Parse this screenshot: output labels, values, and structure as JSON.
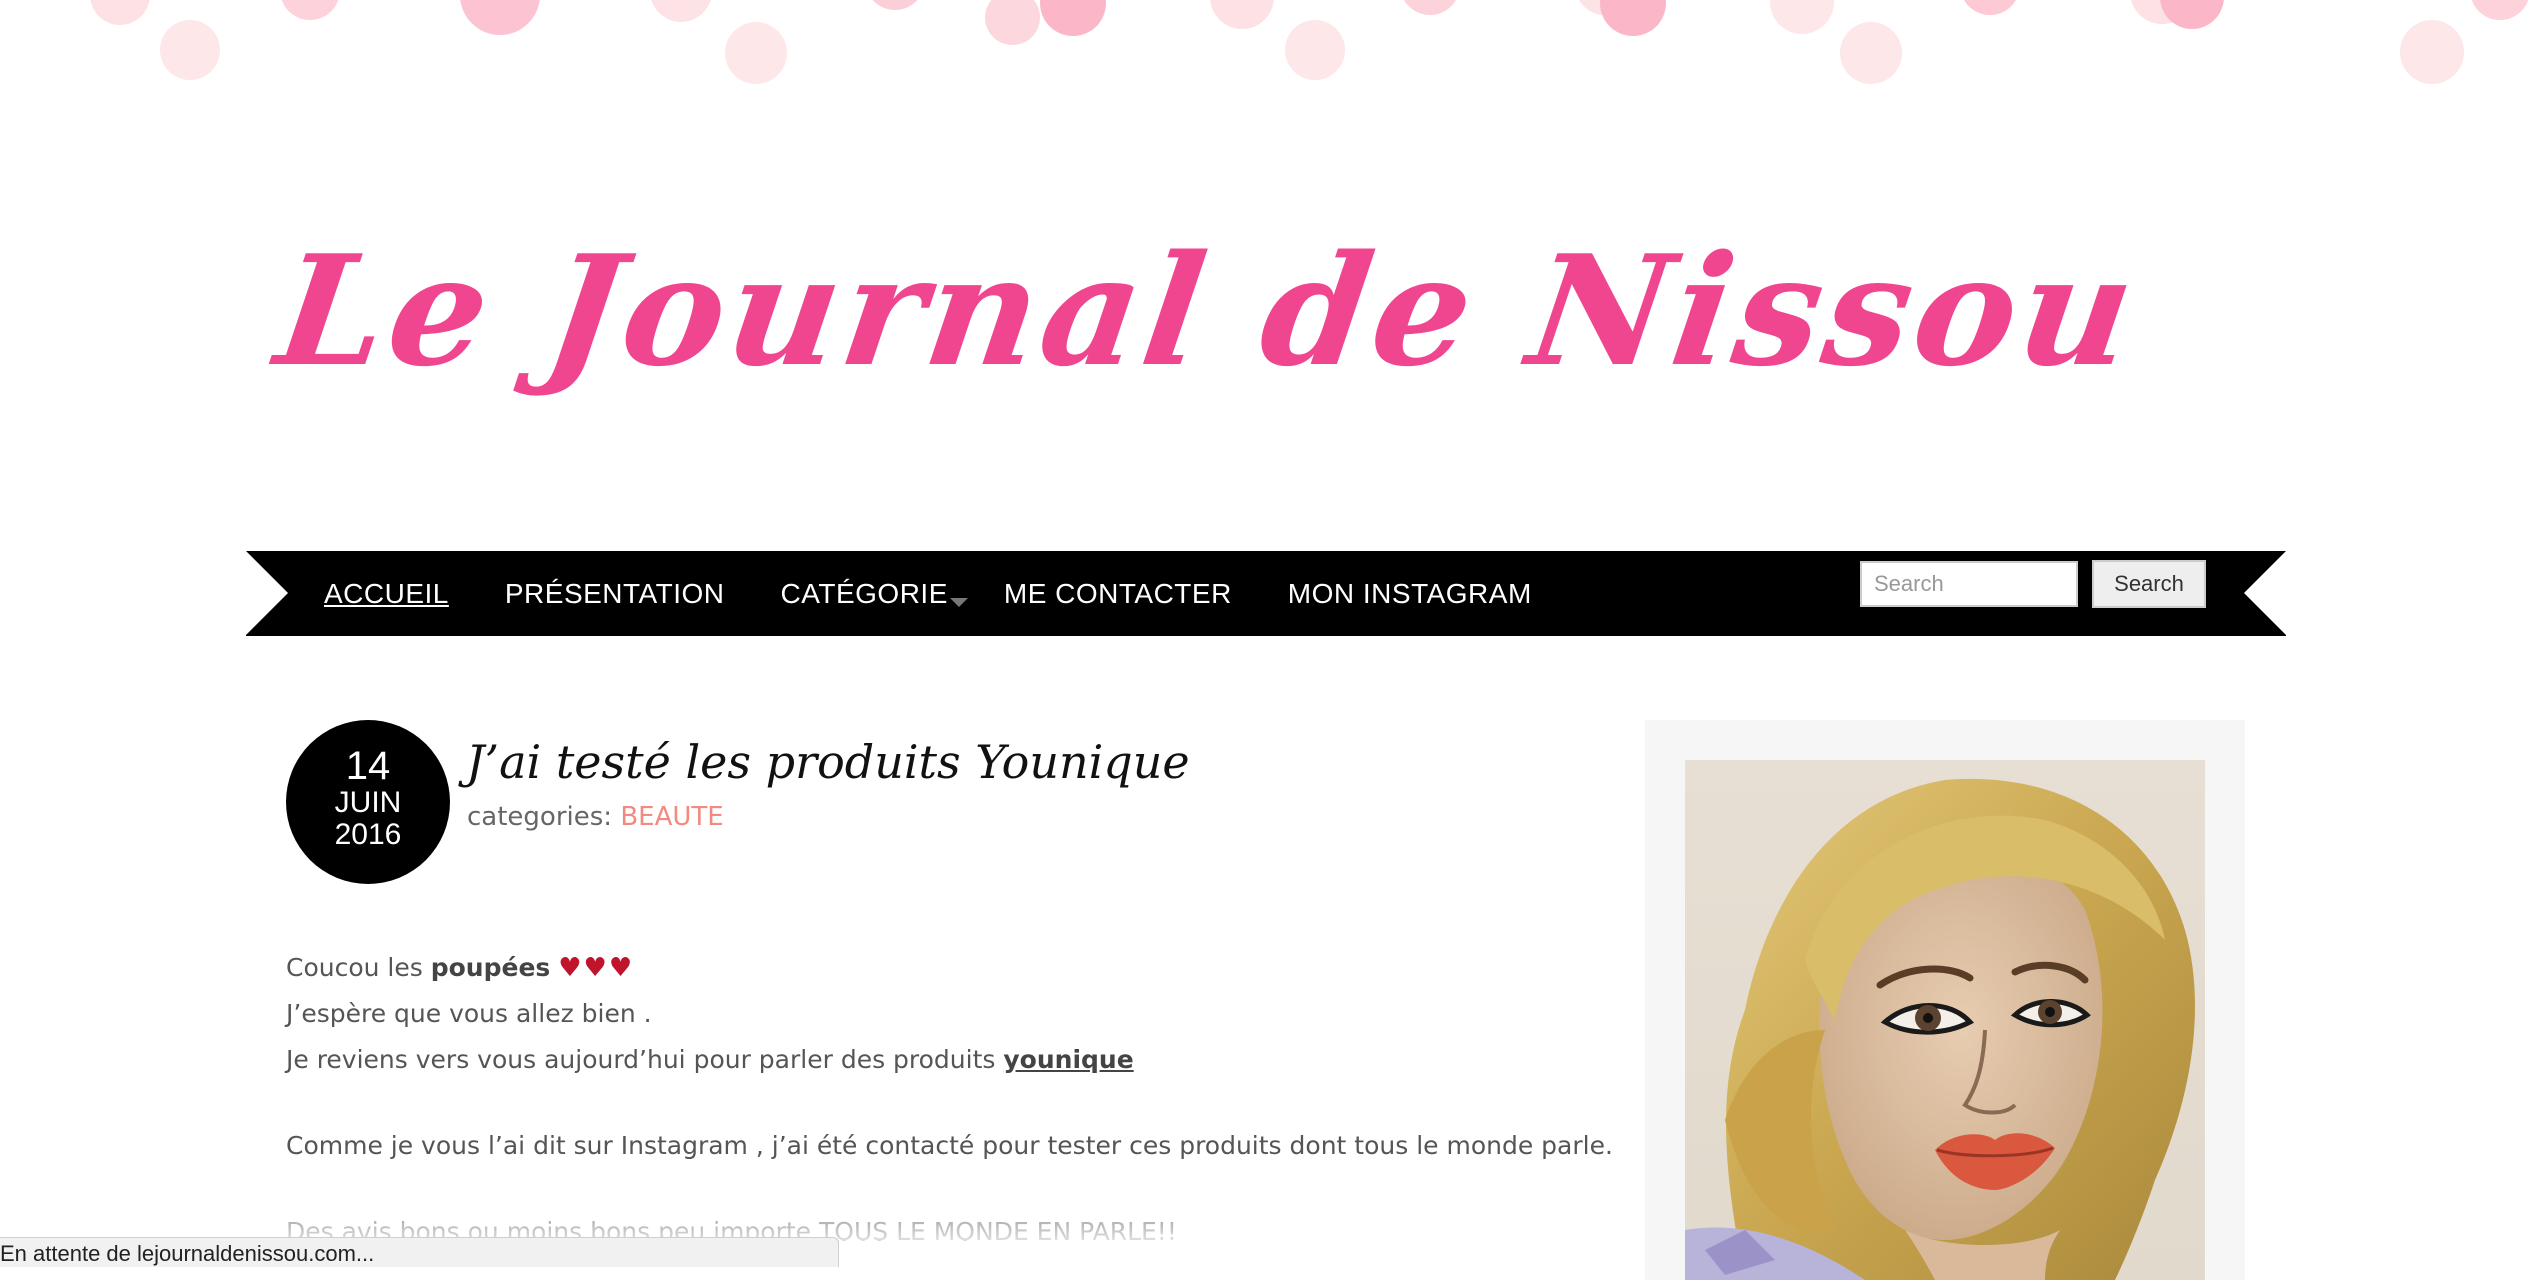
{
  "site": {
    "logo_text": "Le Journal de Nissou",
    "accent_color": "#f0468f"
  },
  "nav": {
    "items": [
      {
        "label": "ACCUEIL",
        "active": true
      },
      {
        "label": "PRÉSENTATION"
      },
      {
        "label": "CATÉGORIE",
        "has_dropdown": true
      },
      {
        "label": "ME CONTACTER"
      },
      {
        "label": "MON INSTAGRAM"
      }
    ],
    "search": {
      "placeholder": "Search",
      "button_label": "Search"
    }
  },
  "post": {
    "date": {
      "day": "14",
      "month": "JUIN",
      "year": "2016"
    },
    "title": "J’ai testé les produits Younique",
    "categories_label": "categories:",
    "category": "BEAUTE",
    "body": {
      "p1_text": "Coucou les ",
      "p1_bold": "poupées",
      "p1_hearts": "♥♥♥",
      "p2": "J’espère que vous allez bien .",
      "p3_text": "Je reviens vers vous aujourd’hui pour parler des produits ",
      "p3_link": "younique",
      "p4": "Comme je vous l’ai dit sur Instagram , j’ai été contacté pour tester ces produits dont tous le monde parle.",
      "p5": "Des avis bons ou moins bons peu importe TOUS LE MONDE EN PARLE!!"
    }
  },
  "sidebar": {
    "portrait_icon": "illustrated-portrait"
  },
  "statusbar": {
    "text": "En attente de lejournaldenissou.com..."
  }
}
